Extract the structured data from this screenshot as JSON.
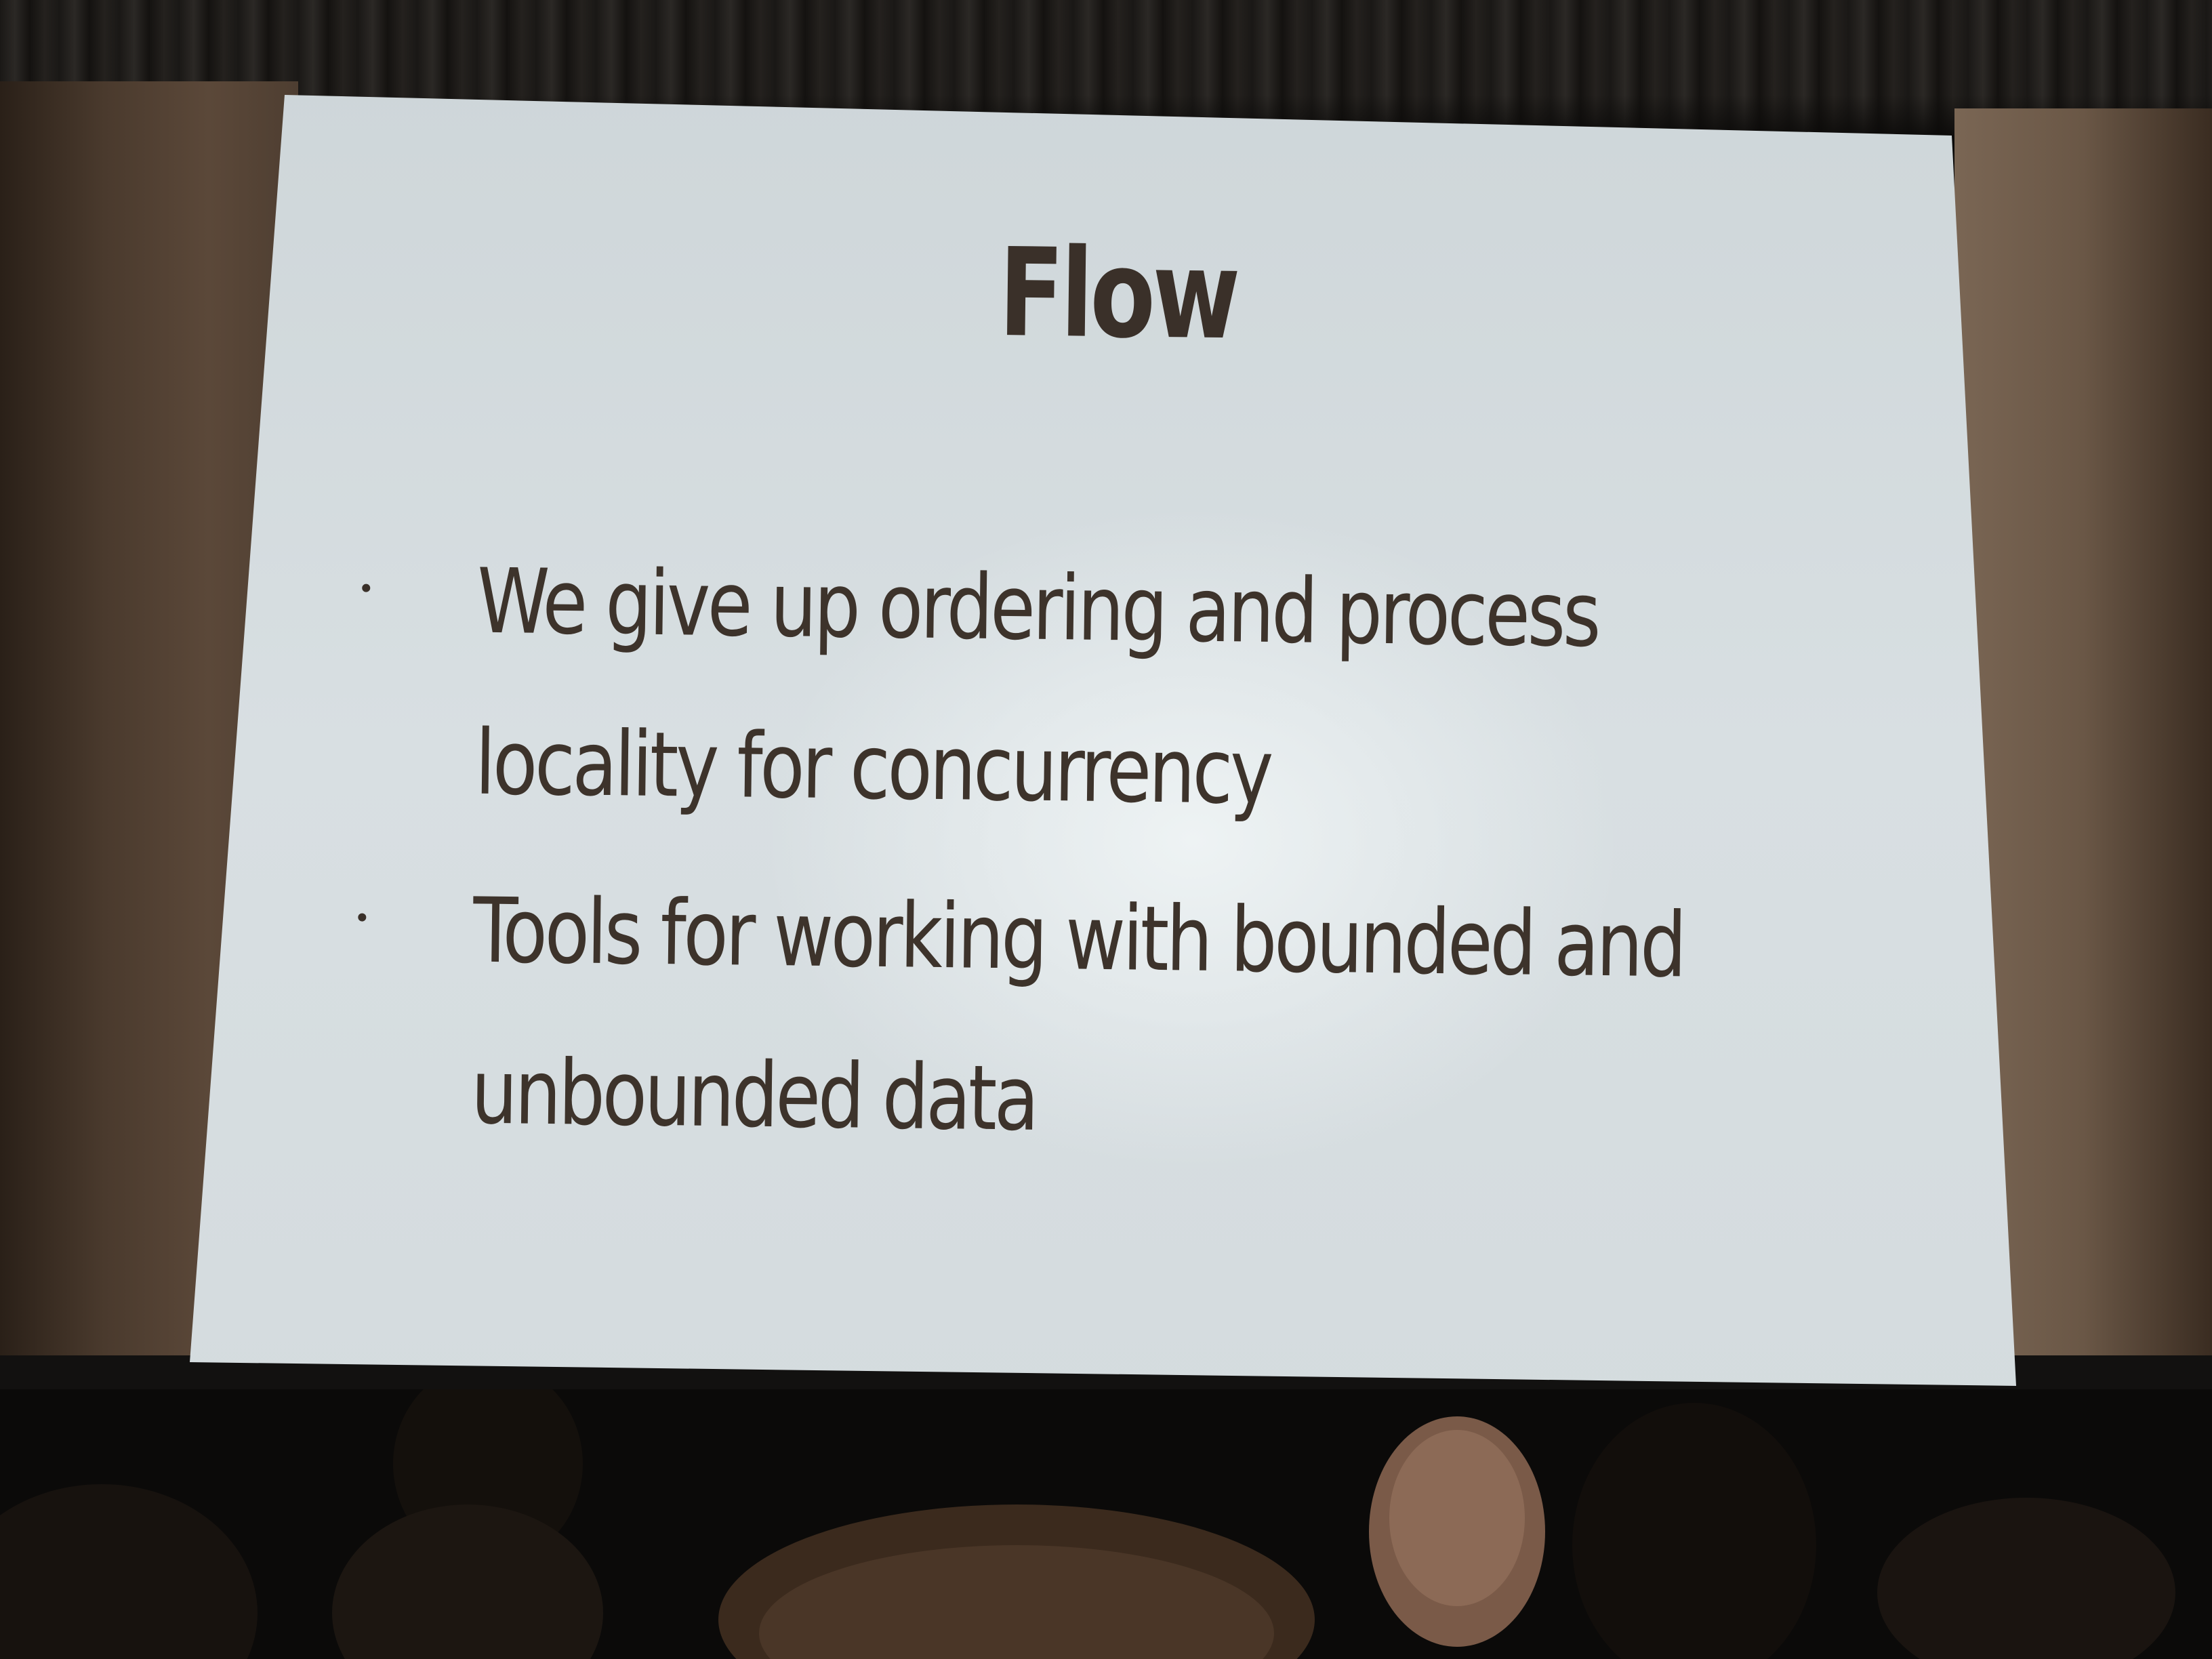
{
  "slide": {
    "title": "Flow",
    "bullets": [
      {
        "line1": "We give up ordering and process",
        "line2": "locality for concurrency"
      },
      {
        "line1": "Tools for working with bounded and",
        "line2": "unbounded data"
      }
    ]
  },
  "colors": {
    "slide_text": "#3d332b",
    "slide_background": "#d8dfe2",
    "wall": "#5b4839",
    "stage_dark": "#0b0a09"
  }
}
